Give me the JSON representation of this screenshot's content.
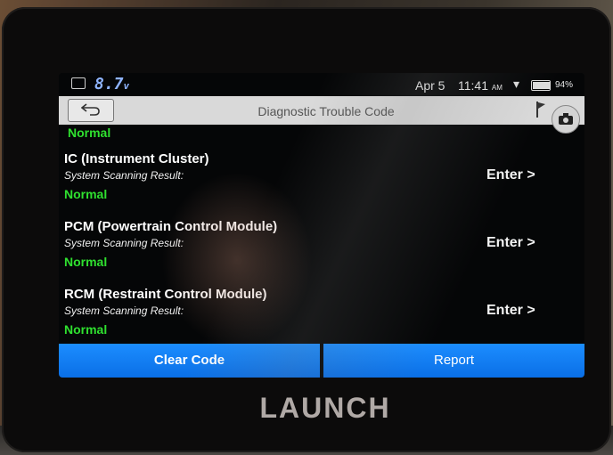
{
  "status_bar": {
    "voltage": "8.7",
    "voltage_unit": "v",
    "date": "Apr 5",
    "time": "11:41",
    "ampm": "AM",
    "battery": "94%",
    "battery_level": 0.94
  },
  "header": {
    "title": "Diagnostic Trouble Code"
  },
  "top_status": "Normal",
  "modules": [
    {
      "name": "IC (Instrument Cluster)",
      "scan_label": "System Scanning Result:",
      "result": "Normal",
      "action": "Enter >"
    },
    {
      "name": "PCM (Powertrain Control Module)",
      "scan_label": "System Scanning Result:",
      "result": "Normal",
      "action": "Enter >"
    },
    {
      "name": "RCM (Restraint Control Module)",
      "scan_label": "System Scanning Result:",
      "result": "Normal",
      "action": "Enter >"
    }
  ],
  "footer": {
    "clear_label": "Clear Code",
    "report_label": "Report"
  },
  "device": {
    "brand": "LAUNCH"
  },
  "colors": {
    "accent": "#1c8dff",
    "status_ok": "#2fe02f"
  }
}
